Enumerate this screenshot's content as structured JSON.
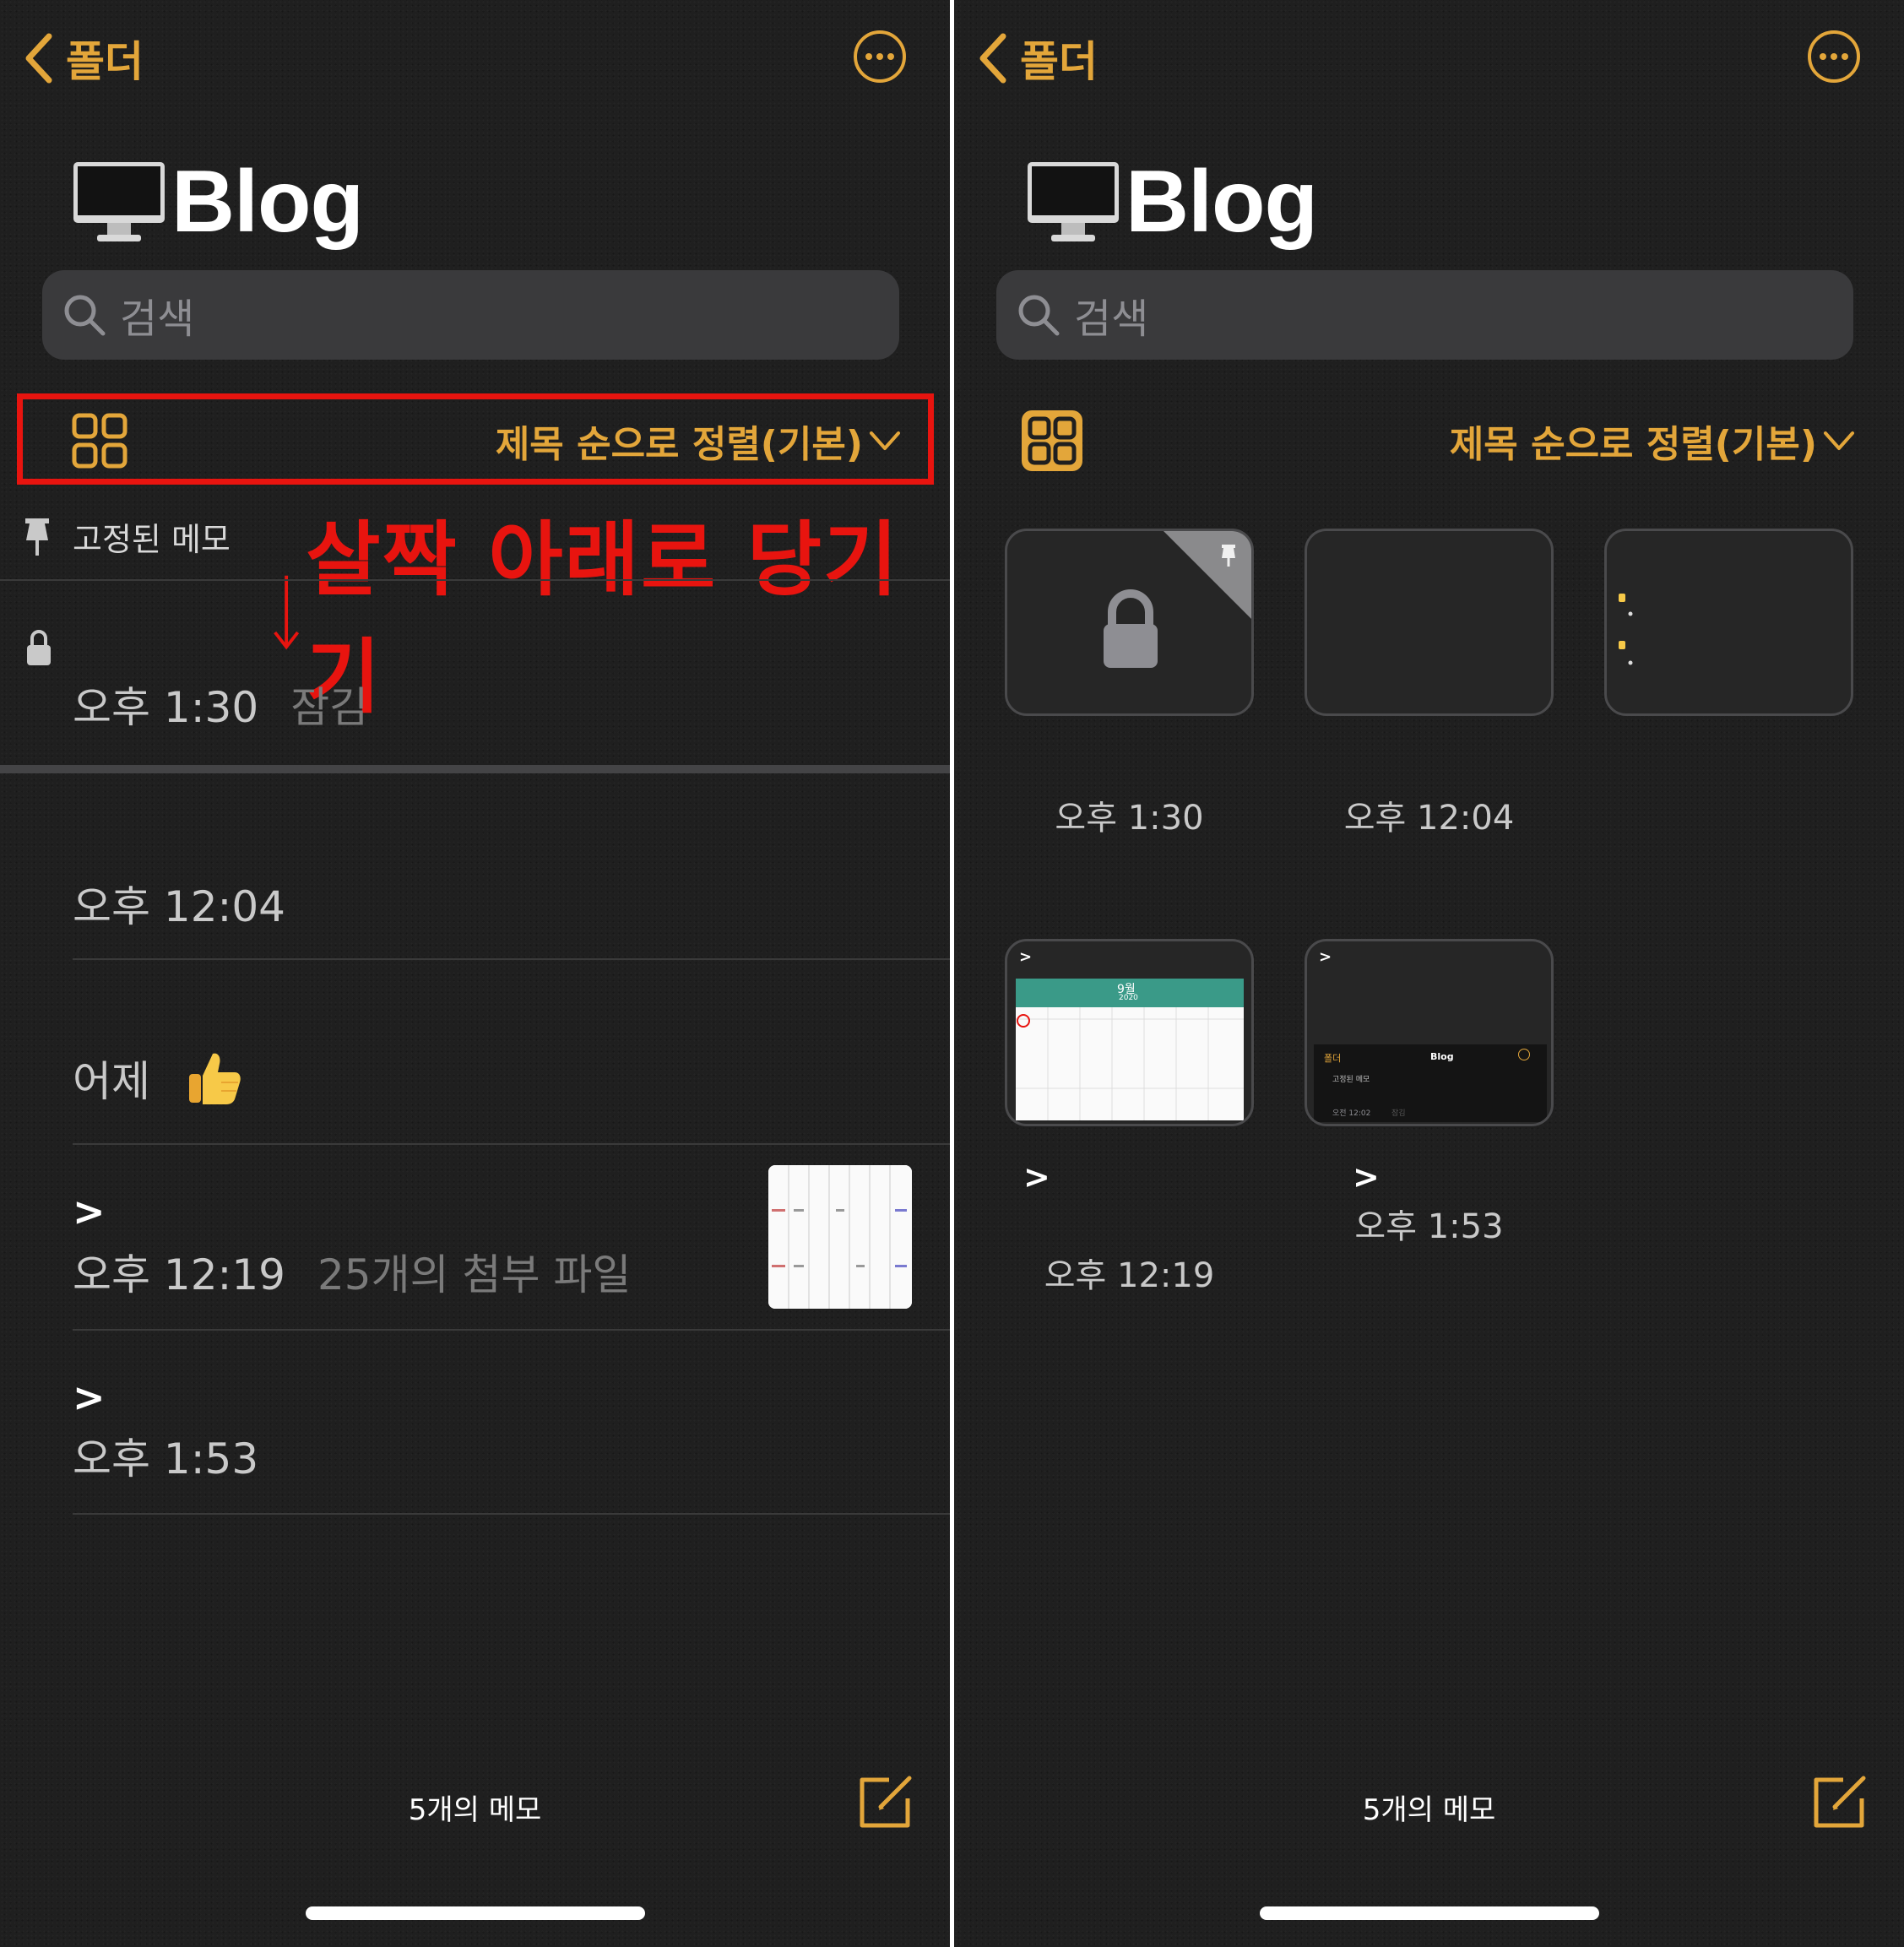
{
  "colors": {
    "accent": "#e3a63a",
    "annotation": "#e8140f",
    "background": "#1f1f1f"
  },
  "left": {
    "nav": {
      "back_label": "폴더",
      "back_icon": "chevron-left-icon",
      "more_icon": "ellipsis-circle-icon"
    },
    "title": "Blog",
    "search": {
      "placeholder": "검색"
    },
    "toolbar": {
      "sort_label": "제목 순으로 정렬(기본)"
    },
    "pinned_header": "고정된 메모",
    "annotation": "살짝 아래로 당기기",
    "notes": [
      {
        "time": "오후 1:30",
        "detail": "잠김",
        "locked": true
      },
      {
        "time": "오후 12:04",
        "detail": ""
      },
      {
        "time": "어제",
        "detail": "👍"
      },
      {
        "title": ">",
        "time": "오후 12:19",
        "detail": "25개의 첨부 파일"
      },
      {
        "title": ">",
        "time": "오후 1:53",
        "detail": ""
      }
    ],
    "footer": {
      "count": "5개의 메모"
    }
  },
  "right": {
    "nav": {
      "back_label": "폴더",
      "back_icon": "chevron-left-icon",
      "more_icon": "ellipsis-circle-icon"
    },
    "title": "Blog",
    "search": {
      "placeholder": "검색"
    },
    "toolbar": {
      "sort_label": "제목 순으로 정렬(기본)"
    },
    "cards": [
      {
        "title": "",
        "time": "오후 1:30",
        "pinned": true,
        "locked": true
      },
      {
        "title": "",
        "time": "오후 12:04"
      },
      {
        "title": "",
        "time": ""
      },
      {
        "title": ">",
        "time": "오후 12:19"
      },
      {
        "title": ">",
        "time": "오후 1:53"
      }
    ],
    "mini_screenshot": {
      "back": "폴더",
      "title": "Blog",
      "pinned": "고정된 메모",
      "time": "오전 12:02",
      "lock": "잠김"
    },
    "mini_calendar": {
      "month": "9월",
      "year": "2020"
    },
    "footer": {
      "count": "5개의 메모"
    }
  }
}
